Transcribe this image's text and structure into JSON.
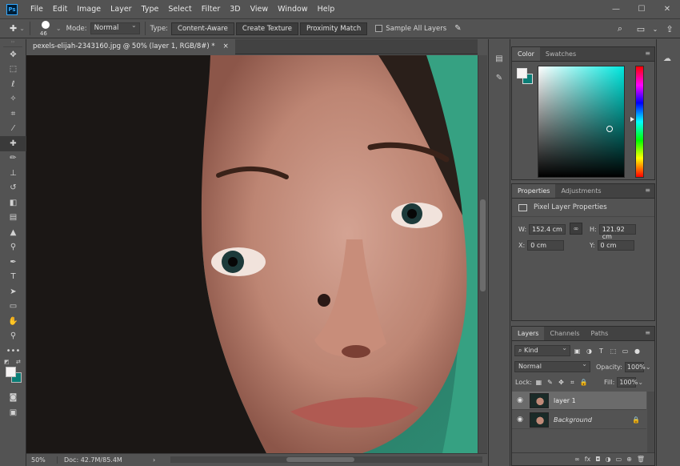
{
  "menu": {
    "logo": "Ps",
    "items": [
      "File",
      "Edit",
      "Image",
      "Layer",
      "Type",
      "Select",
      "Filter",
      "3D",
      "View",
      "Window",
      "Help"
    ],
    "window_controls": [
      "—",
      "☐",
      "✕"
    ]
  },
  "options": {
    "brush_size": "46",
    "mode_label": "Mode:",
    "mode_value": "Normal",
    "type_label": "Type:",
    "type_buttons": [
      "Content-Aware",
      "Create Texture",
      "Proximity Match"
    ],
    "sample_all_label": "Sample All Layers"
  },
  "document": {
    "tab_title": "pexels-elijah-2343160.jpg @ 50% (layer 1, RGB/8#) *",
    "tab_close": "×",
    "zoom": "50%",
    "doc_size": "Doc: 42.7M/85.4M",
    "status_arrow": "›"
  },
  "colors": {
    "foreground": "#f6f3f3",
    "background": "#0b7d76"
  },
  "color_panel": {
    "tabs": [
      "Color",
      "Swatches"
    ],
    "menu_icon": "≡"
  },
  "properties_panel": {
    "tabs": [
      "Properties",
      "Adjustments"
    ],
    "menu_icon": "≡",
    "title": "Pixel Layer Properties",
    "w_label": "W:",
    "w_value": "152.4 cm",
    "h_label": "H:",
    "h_value": "121.92 cm",
    "x_label": "X:",
    "x_value": "0 cm",
    "y_label": "Y:",
    "y_value": "0 cm",
    "link_icon": "∞"
  },
  "layers_panel": {
    "tabs": [
      "Layers",
      "Channels",
      "Paths"
    ],
    "menu_icon": "≡",
    "kind_label": "Kind",
    "blend_mode": "Normal",
    "opacity_label": "Opacity:",
    "opacity_value": "100%",
    "lock_label": "Lock:",
    "fill_label": "Fill:",
    "fill_value": "100%",
    "layers": [
      {
        "name": "layer 1",
        "selected": true
      },
      {
        "name": "Background",
        "selected": false,
        "locked": true
      }
    ],
    "footer_icons": [
      "∞",
      "fx",
      "◘",
      "◑",
      "▭",
      "⊕",
      "🗑"
    ]
  }
}
